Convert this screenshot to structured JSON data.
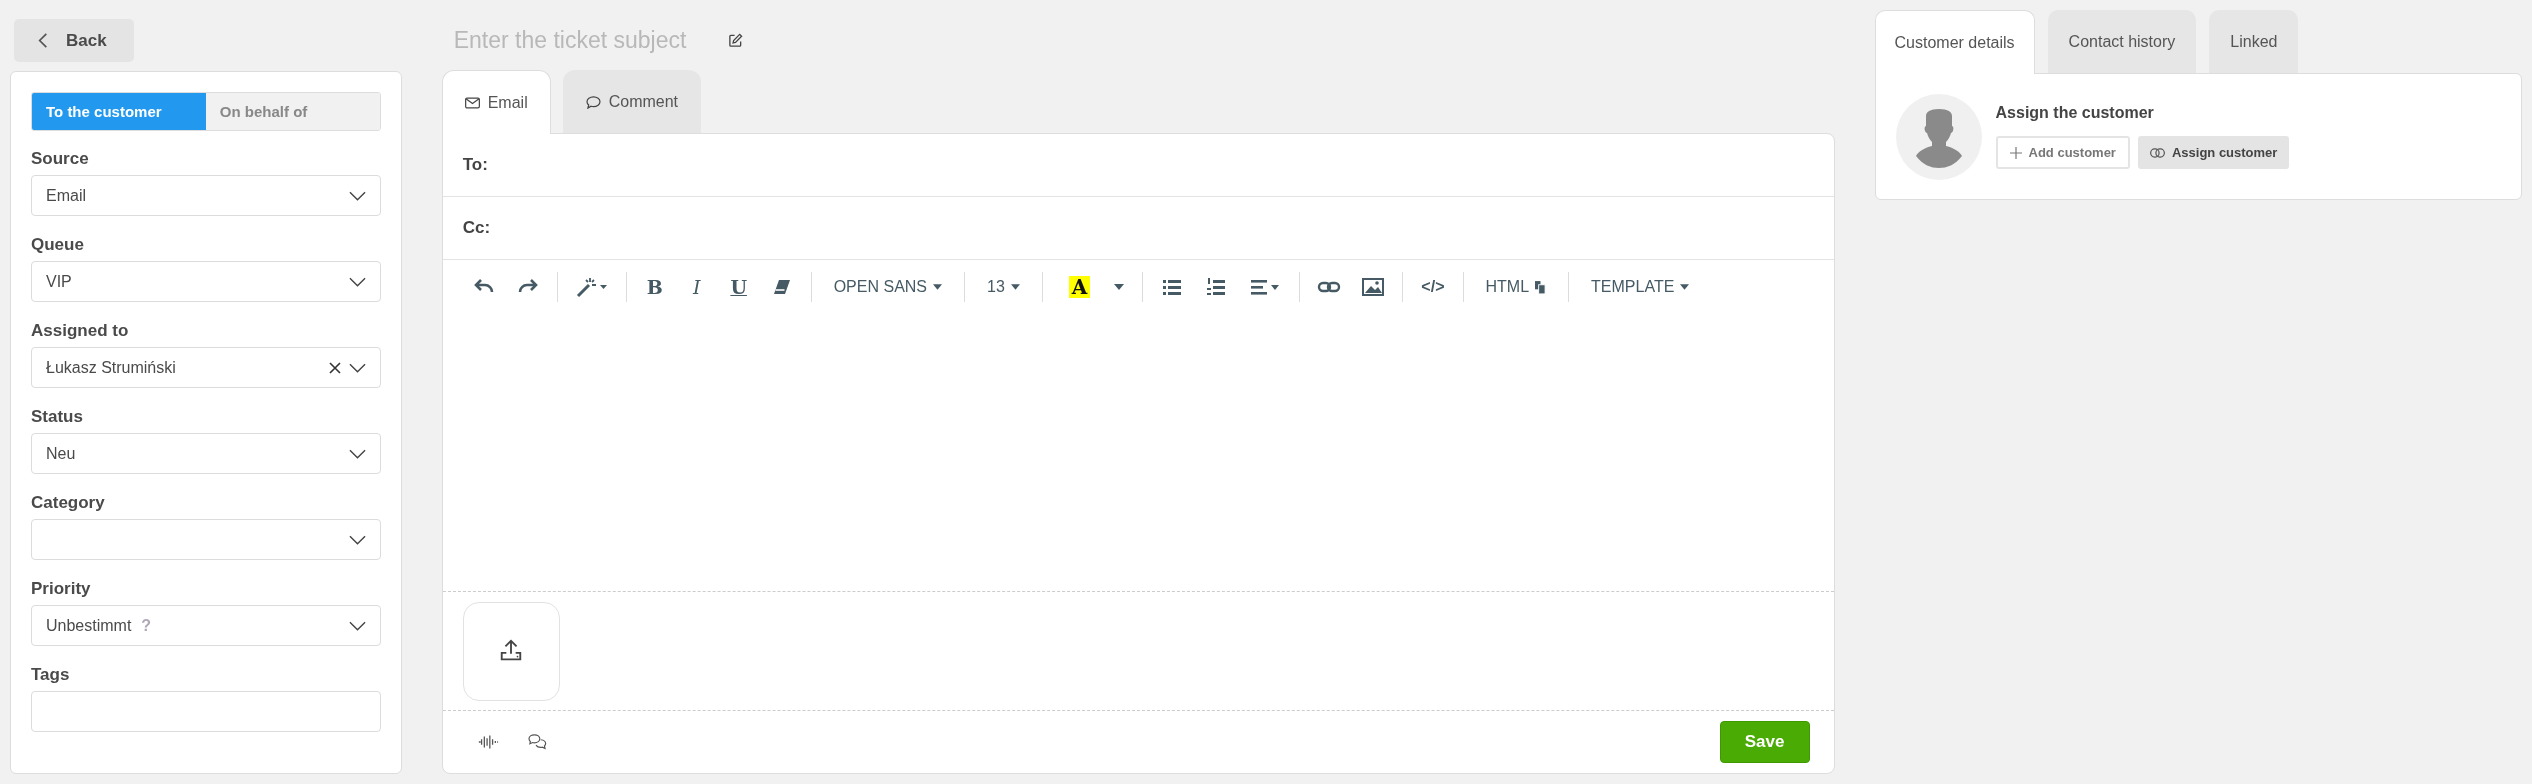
{
  "back": {
    "label": "Back"
  },
  "direction": [
    {
      "label": "To the customer",
      "selected": true
    },
    {
      "label": "On behalf of",
      "selected": false
    }
  ],
  "fields": [
    {
      "kind": "select",
      "label": "Source",
      "value": "Email",
      "clearable": false
    },
    {
      "kind": "select",
      "label": "Queue",
      "value": "VIP",
      "clearable": false
    },
    {
      "kind": "select",
      "label": "Assigned to",
      "value": "Łukasz Strumiński",
      "clearable": true
    },
    {
      "kind": "select",
      "label": "Status",
      "value": "Neu",
      "clearable": false
    },
    {
      "kind": "select",
      "label": "Category",
      "clearable": false
    },
    {
      "kind": "select",
      "label": "Priority",
      "value": "Unbestimmt",
      "hint": "?",
      "clearable": false
    },
    {
      "kind": "input",
      "label": "Tags"
    }
  ],
  "subject": {
    "placeholder": "Enter the ticket subject"
  },
  "compose_tabs": [
    {
      "kind": "email",
      "label": "Email",
      "selected": true
    },
    {
      "kind": "comment",
      "label": "Comment",
      "selected": false
    }
  ],
  "recipients": [
    {
      "label": "To:"
    },
    {
      "label": "Cc:"
    }
  ],
  "toolbar": {
    "bold": "B",
    "italic": "I",
    "underline": "U",
    "font": "OPEN SANS",
    "size": "13",
    "highlight": "A",
    "code": "</>",
    "html": "HTML",
    "template": "TEMPLATE"
  },
  "save_button": {
    "label": "Save"
  },
  "side_tabs": [
    {
      "label": "Customer details",
      "selected": true
    },
    {
      "label": "Contact history",
      "selected": false
    },
    {
      "label": "Linked",
      "selected": false
    }
  ],
  "customer": {
    "title": "Assign the customer",
    "buttons": [
      {
        "kind": "add",
        "label": "Add customer"
      },
      {
        "kind": "assign",
        "label": "Assign customer"
      }
    ]
  }
}
